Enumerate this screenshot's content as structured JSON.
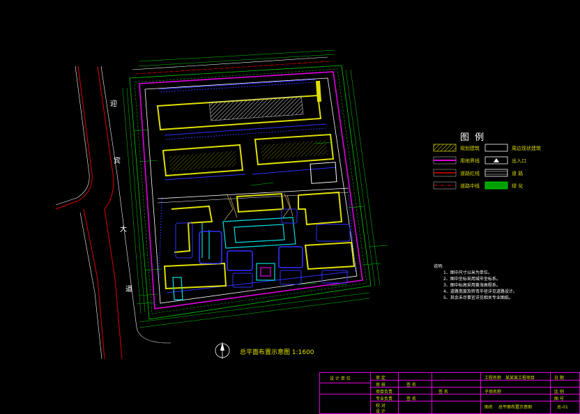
{
  "plan": {
    "title": "总平面布置示意图 1:1600",
    "road_name": [
      "迎",
      "宾",
      "大",
      "道"
    ]
  },
  "legend": {
    "title": "图 例",
    "items": [
      {
        "label": "规划建筑",
        "color": "#c8c800",
        "pattern": "hatch"
      },
      {
        "label": "用地界线",
        "color": "#e000e0",
        "pattern": "line"
      },
      {
        "label": "道路红线",
        "color": "#e00000",
        "pattern": "line"
      },
      {
        "label": "道路中线",
        "color": "#e00000",
        "pattern": "dash"
      },
      {
        "label": "周边现状建筑",
        "color": "#ffffff",
        "pattern": "box"
      },
      {
        "label": "出入口",
        "color": "#ffffff",
        "pattern": "triangle"
      },
      {
        "label": "道 路",
        "color": "#ffffff",
        "pattern": "road"
      },
      {
        "label": "绿 化",
        "color": "#00c000",
        "pattern": "green"
      }
    ]
  },
  "notes": {
    "heading": "说明:",
    "lines": [
      "1、图中尺寸以米为单位。",
      "2、图中坐标采用城市坐标系。",
      "3、图中标高采用黄海高程系。",
      "4、道路宽度及转弯半径详见道路设计。",
      "5、其余未尽事宜详见相关专业图纸。"
    ]
  },
  "title_block": {
    "design_unit": "设 计 单 位",
    "project_label": "工程名称",
    "project_name": "某某某工程项目",
    "drawing_label": "图名",
    "drawing_name": "总平面布置示意图",
    "sub_item": "子项名称",
    "rows_left": [
      "审 定",
      "审 核",
      "项目负责",
      "专业负责",
      "校 对",
      "设 计"
    ],
    "sign": [
      "签 名",
      "签 名",
      "签 名"
    ],
    "date_label": "日 期",
    "scale_label": "比 例",
    "drawing_no": "图 号",
    "sheet": "总-01"
  },
  "colors": {
    "boundary": "#e000e0",
    "road": "#ffffff",
    "green": "#00d000",
    "building": "#e0e000",
    "parking": "#3030ff",
    "red": "#e00000",
    "cyan": "#00e0e0"
  }
}
